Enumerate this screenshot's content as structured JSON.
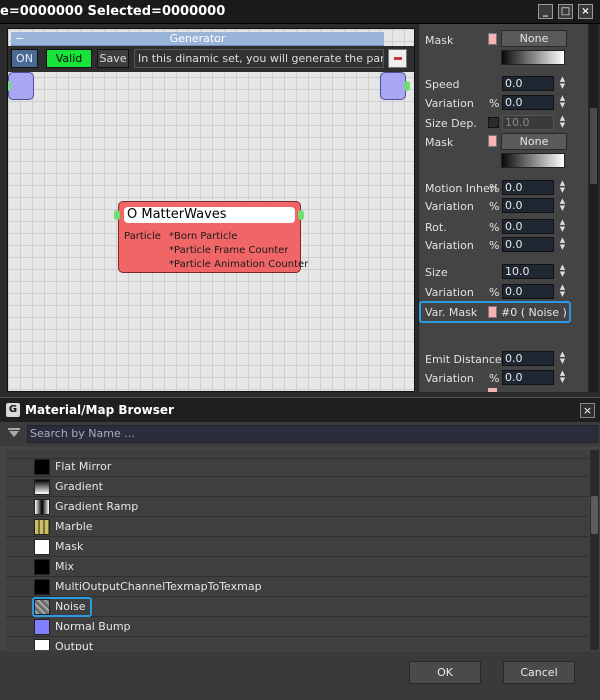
{
  "window": {
    "title": "e=0000000  Selected=0000000",
    "min_icon": "minimize-icon",
    "max_icon": "maximize-icon",
    "close_icon": "close-icon"
  },
  "generator": {
    "header": "Generator",
    "collapse_glyph": "−",
    "on_label": "ON",
    "valid_label": "Valid",
    "save_label": "Save",
    "description": "In this dinamic set, you will generate the particles."
  },
  "node": {
    "title": "O MatterWaves",
    "input_label": "Particle",
    "outputs": [
      "*Born Particle",
      "*Particle Frame Counter",
      "*Particle Animation Counter"
    ]
  },
  "panel": {
    "mask1_label": "Mask",
    "mask1_value": "None",
    "speed_label": "Speed",
    "speed_value": "0.0",
    "variation1_label": "Variation",
    "variation1_value": "0.0",
    "sizedep_label": "Size Dep.",
    "sizedep_value": "10.0",
    "mask2_label": "Mask",
    "mask2_value": "None",
    "motion_label": "Motion Inheri",
    "motion_value": "0.0",
    "variation2_label": "Variation",
    "variation2_value": "0.0",
    "rot_label": "Rot.",
    "rot_value": "0.0",
    "variation3_label": "Variation",
    "variation3_value": "0.0",
    "size_label": "Size",
    "size_value": "10.0",
    "variation4_label": "Variation",
    "variation4_value": "0.0",
    "varmask_label": "Var. Mask",
    "varmask_value": "#0  ( Noise )",
    "emit_label": "Emit Distance",
    "emit_value": "0.0",
    "variation5_label": "Variation",
    "variation5_value": "0.0",
    "pct": "%"
  },
  "browser": {
    "title": "Material/Map Browser",
    "logo": "G",
    "search_placeholder": "Search by Name ...",
    "items": [
      {
        "label": "Flat Mirror",
        "icon": "black-swatch"
      },
      {
        "label": "Gradient",
        "icon": "gradient-swatch"
      },
      {
        "label": "Gradient Ramp",
        "icon": "gradient-ramp-swatch"
      },
      {
        "label": "Marble",
        "icon": "marble-swatch"
      },
      {
        "label": "Mask",
        "icon": "white-swatch"
      },
      {
        "label": "Mix",
        "icon": "black-swatch"
      },
      {
        "label": "MultiOutputChannelTexmapToTexmap",
        "icon": "black-swatch"
      },
      {
        "label": "Noise",
        "icon": "noise-swatch"
      },
      {
        "label": "Normal Bump",
        "icon": "normal-bump-swatch"
      },
      {
        "label": "Output",
        "icon": "white-swatch"
      }
    ],
    "ok_label": "OK",
    "cancel_label": "Cancel"
  },
  "colors": {
    "highlight": "#2a9be0",
    "node_fill": "#f06666",
    "valid_green": "#18e33a"
  }
}
